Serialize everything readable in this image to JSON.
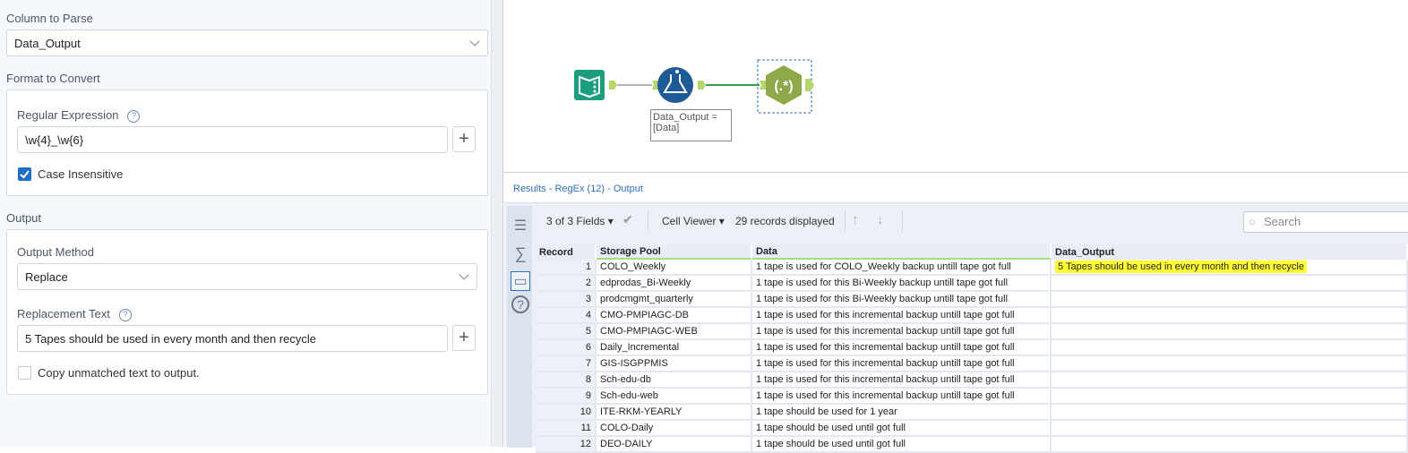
{
  "config": {
    "column_to_parse_label": "Column to Parse",
    "column_to_parse_value": "Data_Output",
    "format_label": "Format to Convert",
    "regex_label": "Regular Expression",
    "regex_value": "\\w{4}_\\w{6}",
    "case_insensitive_label": "Case Insensitive",
    "case_insensitive_checked": true,
    "output_label": "Output",
    "output_method_label": "Output Method",
    "output_method_value": "Replace",
    "replacement_label": "Replacement Text",
    "replacement_value": "5 Tapes should be used in every month and then recycle",
    "copy_unmatched_label": "Copy unmatched text to output.",
    "copy_unmatched_checked": false,
    "help_glyph": "?",
    "plus_glyph": "+"
  },
  "canvas": {
    "formula_annotation_line1": "Data_Output =",
    "formula_annotation_line2": "[Data]",
    "regex_tool_label": "(.*)"
  },
  "results": {
    "title": "Results - RegEx (12) - Output",
    "fields": "3 of 3 Fields",
    "viewer": "Cell Viewer",
    "records": "29 records displayed",
    "search_placeholder": "Search",
    "columns": [
      "Record",
      "Storage Pool",
      "Data",
      "Data_Output"
    ],
    "rows": [
      [
        "1",
        "COLO_Weekly",
        "1 tape is used for COLO_Weekly backup untill tape got full",
        "5 Tapes should be used in every month and then recycle"
      ],
      [
        "2",
        "edprodas_Bi-Weekly",
        "1 tape is used for this Bi-Weekly backup untill tape got full",
        ""
      ],
      [
        "3",
        "prodcmgmt_quarterly",
        "1 tape is used for this Bi-Weekly backup untill tape got full",
        ""
      ],
      [
        "4",
        "CMO-PMPIAGC-DB",
        "1 tape is used for this incremental backup untill tape got full",
        ""
      ],
      [
        "5",
        "CMO-PMPIAGC-WEB",
        "1 tape is used for this incremental backup untill tape got full",
        ""
      ],
      [
        "6",
        "Daily_Incremental",
        "1 tape is used for this incremental backup untill tape got full",
        ""
      ],
      [
        "7",
        "GIS-ISGPPMIS",
        "1 tape is used for this incremental backup untill tape got full",
        ""
      ],
      [
        "8",
        "Sch-edu-db",
        "1 tape is used for this incremental backup untill tape got full",
        ""
      ],
      [
        "9",
        "Sch-edu-web",
        "1 tape is used for this incremental backup untill tape got full",
        ""
      ],
      [
        "10",
        "ITE-RKM-YEARLY",
        "1 tape should be used for 1 year",
        ""
      ],
      [
        "11",
        "COLO-Daily",
        "1 tape should be used until got full",
        ""
      ],
      [
        "12",
        "DEO-DAILY",
        "1 tape should be used until got full",
        ""
      ]
    ]
  },
  "colors": {
    "highlight": "#ffff33",
    "accent": "#1f6fc5",
    "regex_tool": "#8fa84a",
    "input_tool": "#1a9e7e",
    "formula_tool": "#1e5a96"
  }
}
